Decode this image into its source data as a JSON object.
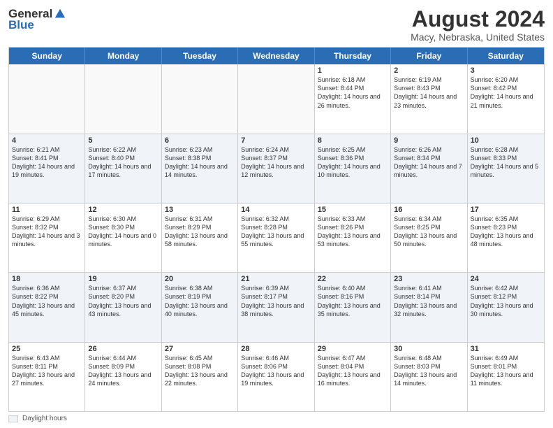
{
  "logo": {
    "general": "General",
    "blue": "Blue",
    "tagline": ""
  },
  "title": "August 2024",
  "subtitle": "Macy, Nebraska, United States",
  "days_of_week": [
    "Sunday",
    "Monday",
    "Tuesday",
    "Wednesday",
    "Thursday",
    "Friday",
    "Saturday"
  ],
  "footer": {
    "legend_label": "Daylight hours"
  },
  "weeks": [
    [
      {
        "day": "",
        "info": "",
        "empty": true
      },
      {
        "day": "",
        "info": "",
        "empty": true
      },
      {
        "day": "",
        "info": "",
        "empty": true
      },
      {
        "day": "",
        "info": "",
        "empty": true
      },
      {
        "day": "1",
        "info": "Sunrise: 6:18 AM\nSunset: 8:44 PM\nDaylight: 14 hours and 26 minutes."
      },
      {
        "day": "2",
        "info": "Sunrise: 6:19 AM\nSunset: 8:43 PM\nDaylight: 14 hours and 23 minutes."
      },
      {
        "day": "3",
        "info": "Sunrise: 6:20 AM\nSunset: 8:42 PM\nDaylight: 14 hours and 21 minutes."
      }
    ],
    [
      {
        "day": "4",
        "info": "Sunrise: 6:21 AM\nSunset: 8:41 PM\nDaylight: 14 hours and 19 minutes."
      },
      {
        "day": "5",
        "info": "Sunrise: 6:22 AM\nSunset: 8:40 PM\nDaylight: 14 hours and 17 minutes."
      },
      {
        "day": "6",
        "info": "Sunrise: 6:23 AM\nSunset: 8:38 PM\nDaylight: 14 hours and 14 minutes."
      },
      {
        "day": "7",
        "info": "Sunrise: 6:24 AM\nSunset: 8:37 PM\nDaylight: 14 hours and 12 minutes."
      },
      {
        "day": "8",
        "info": "Sunrise: 6:25 AM\nSunset: 8:36 PM\nDaylight: 14 hours and 10 minutes."
      },
      {
        "day": "9",
        "info": "Sunrise: 6:26 AM\nSunset: 8:34 PM\nDaylight: 14 hours and 7 minutes."
      },
      {
        "day": "10",
        "info": "Sunrise: 6:28 AM\nSunset: 8:33 PM\nDaylight: 14 hours and 5 minutes."
      }
    ],
    [
      {
        "day": "11",
        "info": "Sunrise: 6:29 AM\nSunset: 8:32 PM\nDaylight: 14 hours and 3 minutes."
      },
      {
        "day": "12",
        "info": "Sunrise: 6:30 AM\nSunset: 8:30 PM\nDaylight: 14 hours and 0 minutes."
      },
      {
        "day": "13",
        "info": "Sunrise: 6:31 AM\nSunset: 8:29 PM\nDaylight: 13 hours and 58 minutes."
      },
      {
        "day": "14",
        "info": "Sunrise: 6:32 AM\nSunset: 8:28 PM\nDaylight: 13 hours and 55 minutes."
      },
      {
        "day": "15",
        "info": "Sunrise: 6:33 AM\nSunset: 8:26 PM\nDaylight: 13 hours and 53 minutes."
      },
      {
        "day": "16",
        "info": "Sunrise: 6:34 AM\nSunset: 8:25 PM\nDaylight: 13 hours and 50 minutes."
      },
      {
        "day": "17",
        "info": "Sunrise: 6:35 AM\nSunset: 8:23 PM\nDaylight: 13 hours and 48 minutes."
      }
    ],
    [
      {
        "day": "18",
        "info": "Sunrise: 6:36 AM\nSunset: 8:22 PM\nDaylight: 13 hours and 45 minutes."
      },
      {
        "day": "19",
        "info": "Sunrise: 6:37 AM\nSunset: 8:20 PM\nDaylight: 13 hours and 43 minutes."
      },
      {
        "day": "20",
        "info": "Sunrise: 6:38 AM\nSunset: 8:19 PM\nDaylight: 13 hours and 40 minutes."
      },
      {
        "day": "21",
        "info": "Sunrise: 6:39 AM\nSunset: 8:17 PM\nDaylight: 13 hours and 38 minutes."
      },
      {
        "day": "22",
        "info": "Sunrise: 6:40 AM\nSunset: 8:16 PM\nDaylight: 13 hours and 35 minutes."
      },
      {
        "day": "23",
        "info": "Sunrise: 6:41 AM\nSunset: 8:14 PM\nDaylight: 13 hours and 32 minutes."
      },
      {
        "day": "24",
        "info": "Sunrise: 6:42 AM\nSunset: 8:12 PM\nDaylight: 13 hours and 30 minutes."
      }
    ],
    [
      {
        "day": "25",
        "info": "Sunrise: 6:43 AM\nSunset: 8:11 PM\nDaylight: 13 hours and 27 minutes."
      },
      {
        "day": "26",
        "info": "Sunrise: 6:44 AM\nSunset: 8:09 PM\nDaylight: 13 hours and 24 minutes."
      },
      {
        "day": "27",
        "info": "Sunrise: 6:45 AM\nSunset: 8:08 PM\nDaylight: 13 hours and 22 minutes."
      },
      {
        "day": "28",
        "info": "Sunrise: 6:46 AM\nSunset: 8:06 PM\nDaylight: 13 hours and 19 minutes."
      },
      {
        "day": "29",
        "info": "Sunrise: 6:47 AM\nSunset: 8:04 PM\nDaylight: 13 hours and 16 minutes."
      },
      {
        "day": "30",
        "info": "Sunrise: 6:48 AM\nSunset: 8:03 PM\nDaylight: 13 hours and 14 minutes."
      },
      {
        "day": "31",
        "info": "Sunrise: 6:49 AM\nSunset: 8:01 PM\nDaylight: 13 hours and 11 minutes."
      }
    ]
  ]
}
